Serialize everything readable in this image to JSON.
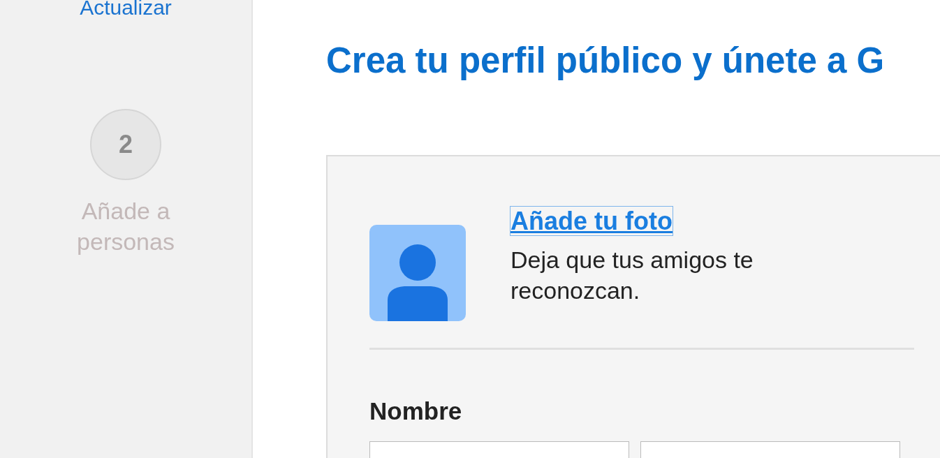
{
  "sidebar": {
    "link": "Actualizar",
    "steps": [
      {
        "number": "2",
        "label": "Añade a personas",
        "active": false
      }
    ]
  },
  "title": "Crea tu perfil público y únete a G",
  "photo": {
    "link": "Añade tu foto",
    "description": "Deja que tus amigos te reconozcan."
  },
  "name_section": {
    "label": "Nombre",
    "inputs": [
      {
        "kind": "text"
      },
      {
        "kind": "text"
      }
    ]
  }
}
